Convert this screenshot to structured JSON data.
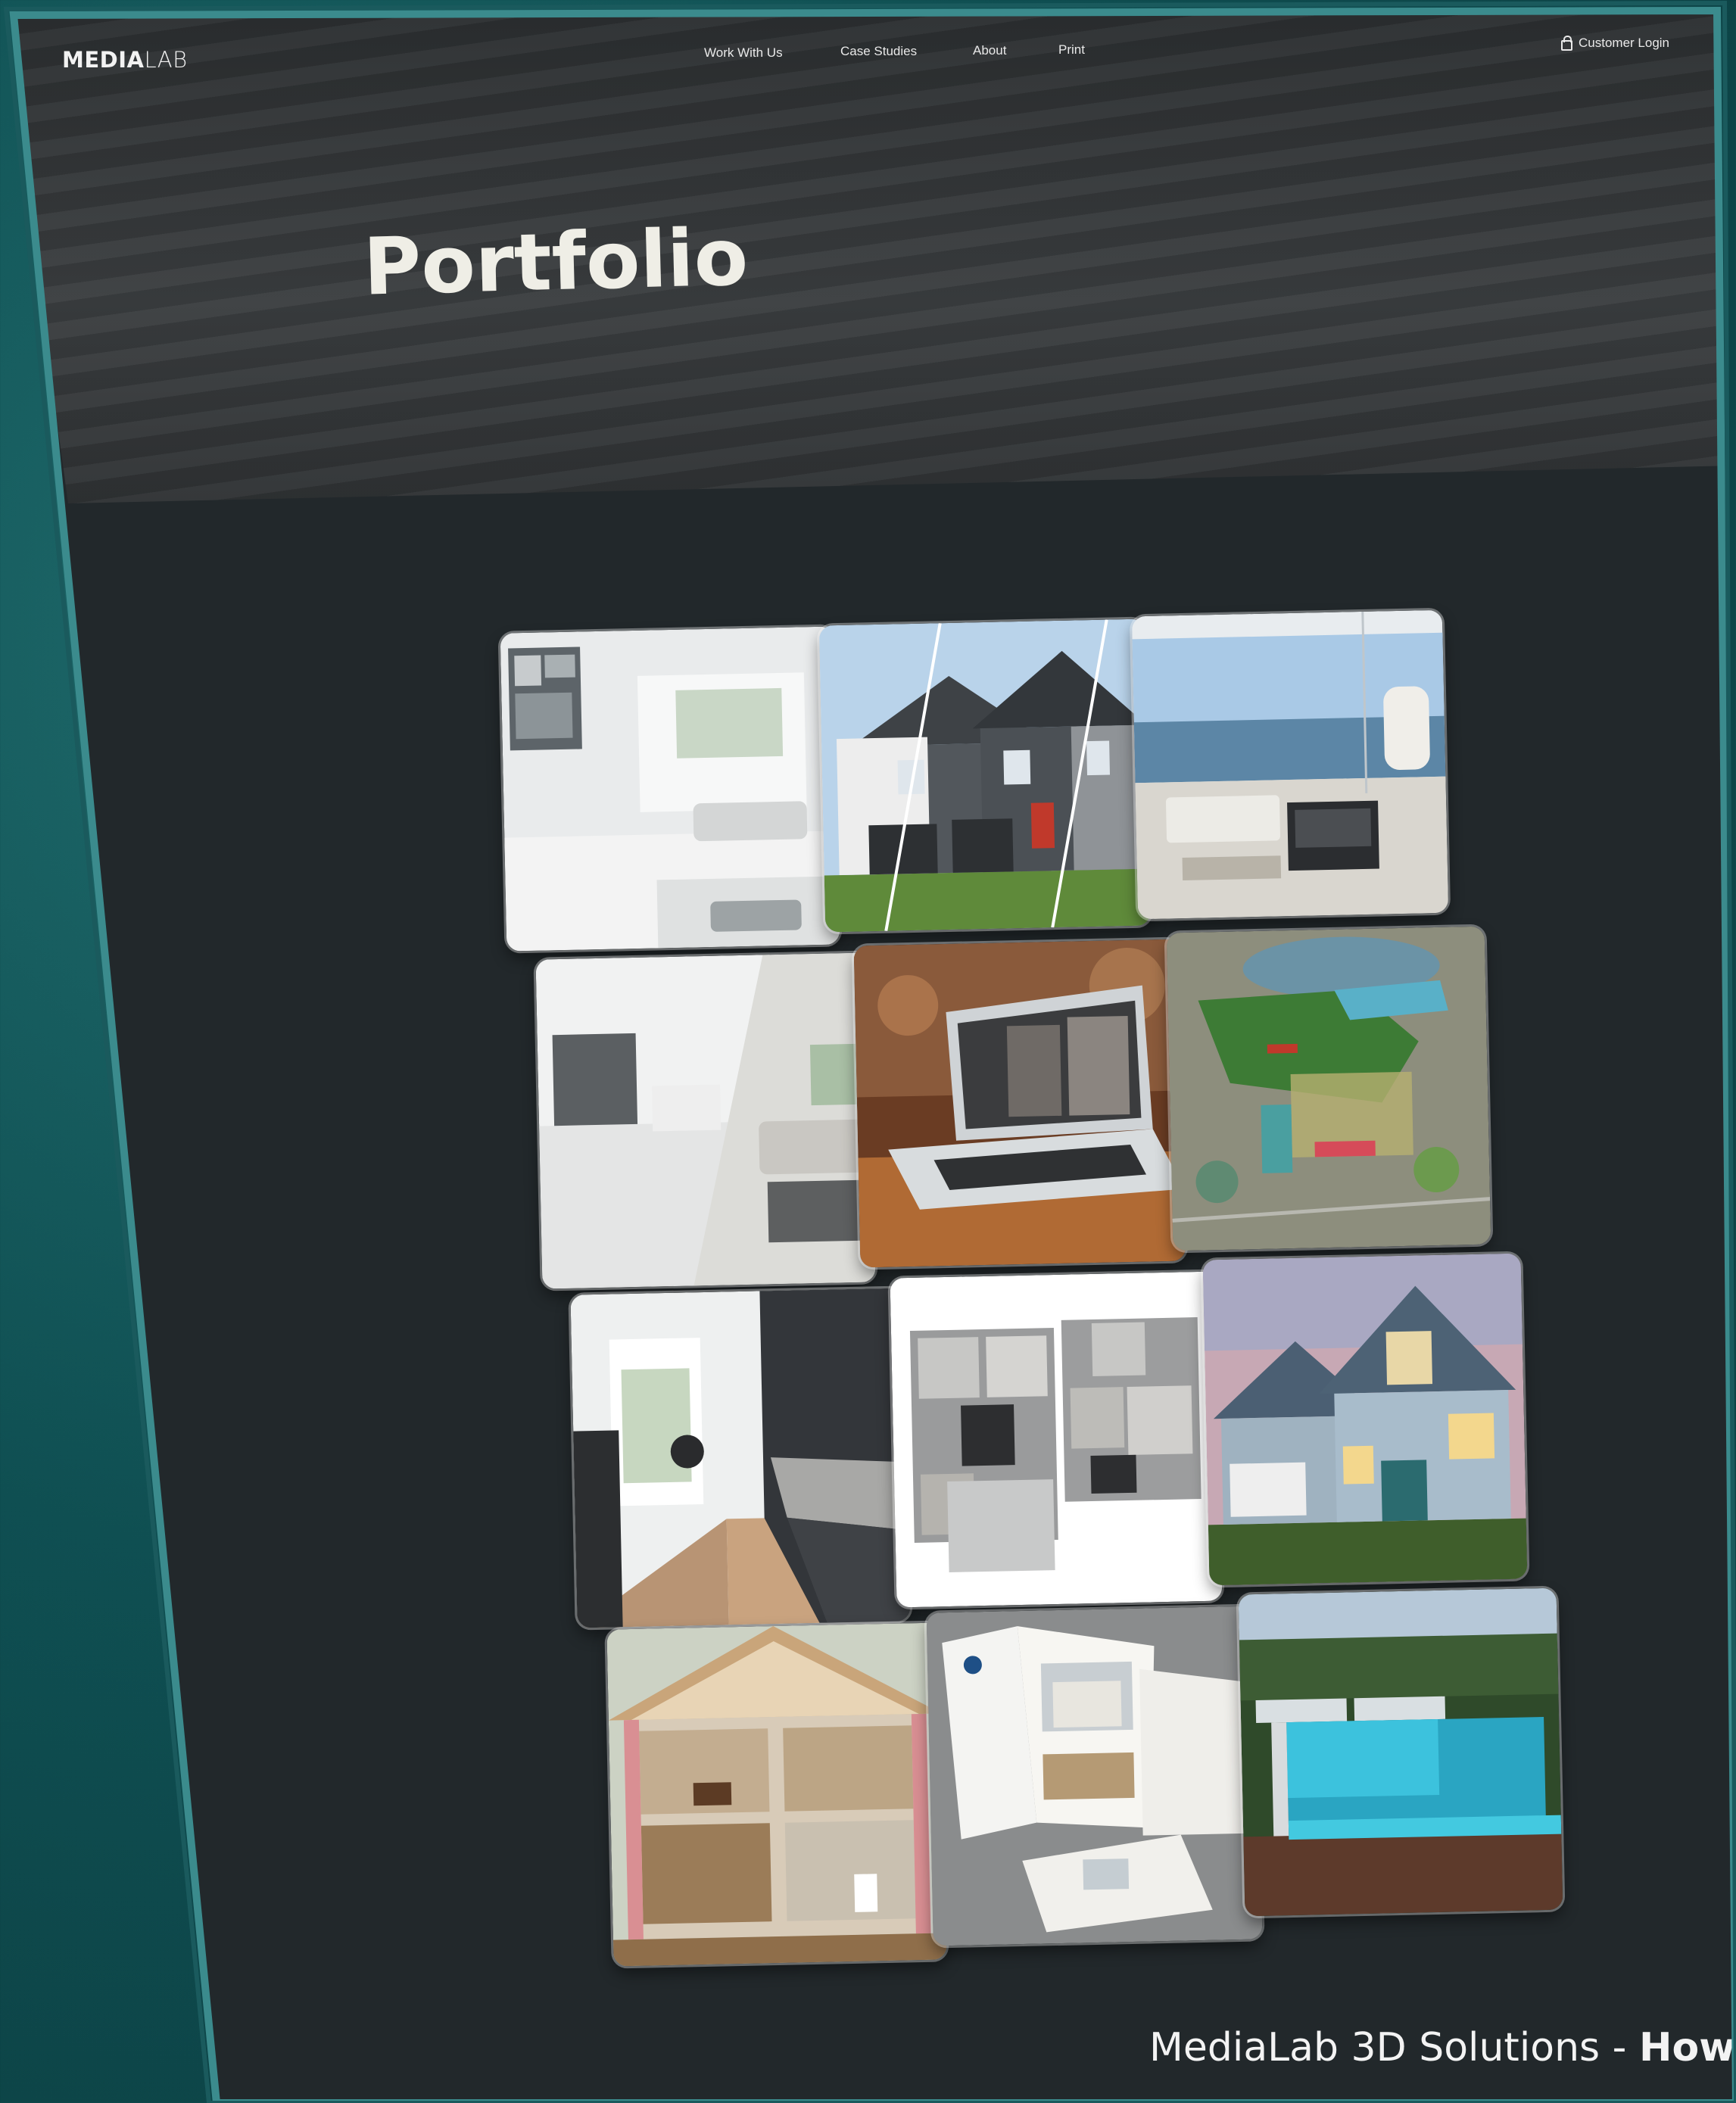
{
  "logo": {
    "bold": "MEDIA",
    "light": "LAB"
  },
  "nav": {
    "items": [
      "Work With Us",
      "Case Studies",
      "About",
      "Print"
    ],
    "login": "Customer Login"
  },
  "hero": {
    "title": "Portfolio"
  },
  "portfolio": {
    "tiles": [
      {
        "icon": "virtual-tour-living-room-image"
      },
      {
        "icon": "exterior-color-options-image"
      },
      {
        "icon": "ocean-view-living-room-image"
      },
      {
        "icon": "staged-interior-image"
      },
      {
        "icon": "laptop-virtual-tour-image"
      },
      {
        "icon": "community-site-map-image"
      },
      {
        "icon": "kitchen-interior-image"
      },
      {
        "icon": "3d-floor-plan-image"
      },
      {
        "icon": "exterior-rendering-image"
      },
      {
        "icon": "home-cutaway-image"
      },
      {
        "icon": "brochure-print-image"
      },
      {
        "icon": "pool-rendering-image"
      }
    ]
  },
  "caption": {
    "light": "MediaLab 3D Solutions - ",
    "bold": "How w"
  },
  "colors": {
    "background": "#0f4f52",
    "screen": "#22282b",
    "hero": "#333638"
  }
}
